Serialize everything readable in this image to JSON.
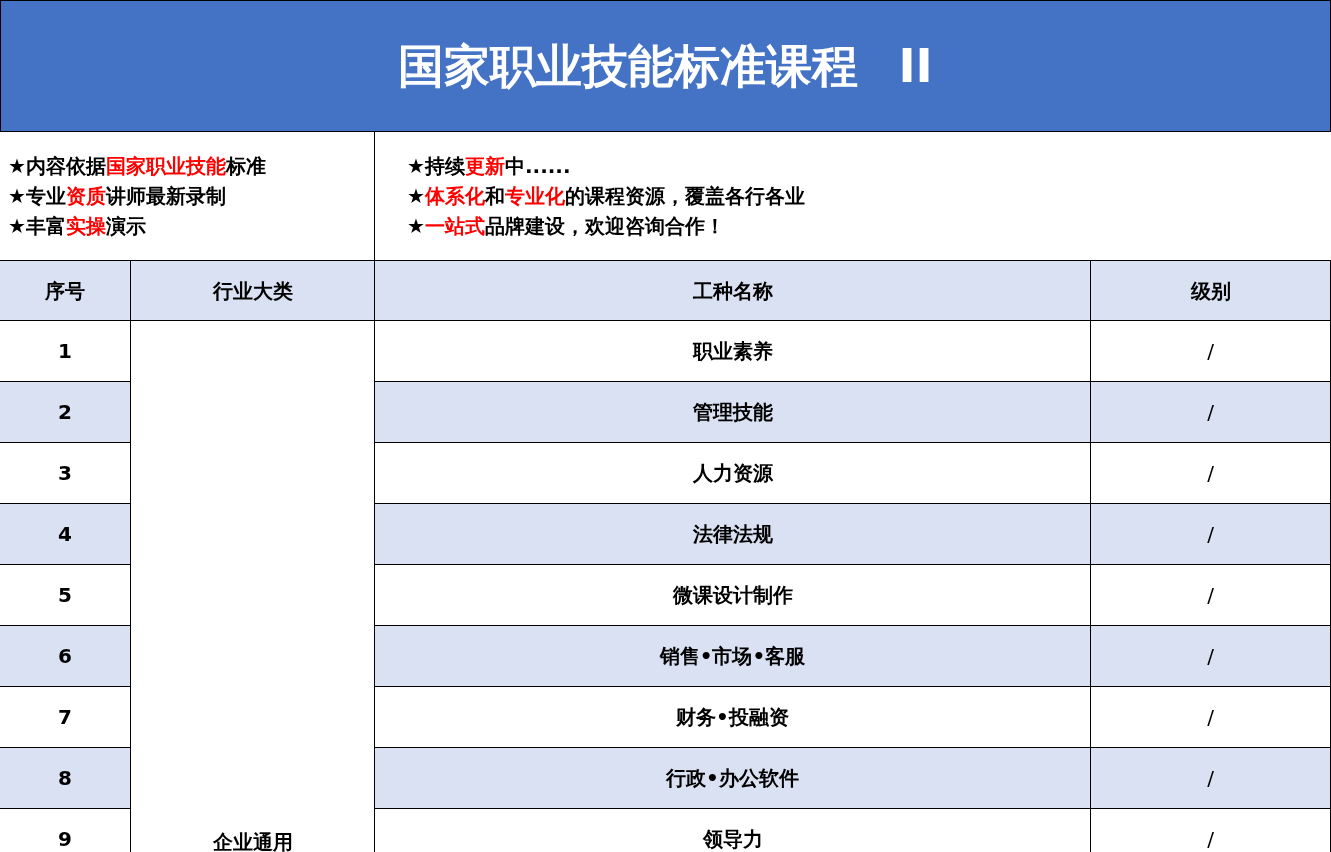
{
  "title": {
    "text": "国家职业技能标准课程",
    "suffix": "II"
  },
  "info_left": [
    [
      {
        "text": "★内容依据"
      },
      {
        "text": "国家职业技能",
        "highlight": true
      },
      {
        "text": "标准"
      }
    ],
    [
      {
        "text": "★专业"
      },
      {
        "text": "资质",
        "highlight": true
      },
      {
        "text": "讲师最新录制"
      }
    ],
    [
      {
        "text": "★丰富"
      },
      {
        "text": "实操",
        "highlight": true
      },
      {
        "text": "演示"
      }
    ]
  ],
  "info_right": [
    [
      {
        "text": "★持续"
      },
      {
        "text": "更新",
        "highlight": true
      },
      {
        "text": "中......"
      }
    ],
    [
      {
        "text": "★"
      },
      {
        "text": "体系化",
        "highlight": true
      },
      {
        "text": "和"
      },
      {
        "text": "专业化",
        "highlight": true
      },
      {
        "text": "的课程资源，覆盖各行各业"
      }
    ],
    [
      {
        "text": "★"
      },
      {
        "text": "一站式",
        "highlight": true
      },
      {
        "text": "品牌建设，欢迎咨询合作！"
      }
    ]
  ],
  "table": {
    "columns": [
      "序号",
      "行业大类",
      "工种名称",
      "级别"
    ],
    "category": "企业通用",
    "rows": [
      {
        "no": "1",
        "name": "职业素养",
        "level": "/"
      },
      {
        "no": "2",
        "name": "管理技能",
        "level": "/"
      },
      {
        "no": "3",
        "name": "人力资源",
        "level": "/"
      },
      {
        "no": "4",
        "name": "法律法规",
        "level": "/"
      },
      {
        "no": "5",
        "name": "微课设计制作",
        "level": "/"
      },
      {
        "no": "6",
        "name": "销售•市场•客服",
        "level": "/"
      },
      {
        "no": "7",
        "name": "财务•投融资",
        "level": "/"
      },
      {
        "no": "8",
        "name": "行政•办公软件",
        "level": "/"
      },
      {
        "no": "9",
        "name": "领导力",
        "level": "/"
      }
    ]
  }
}
